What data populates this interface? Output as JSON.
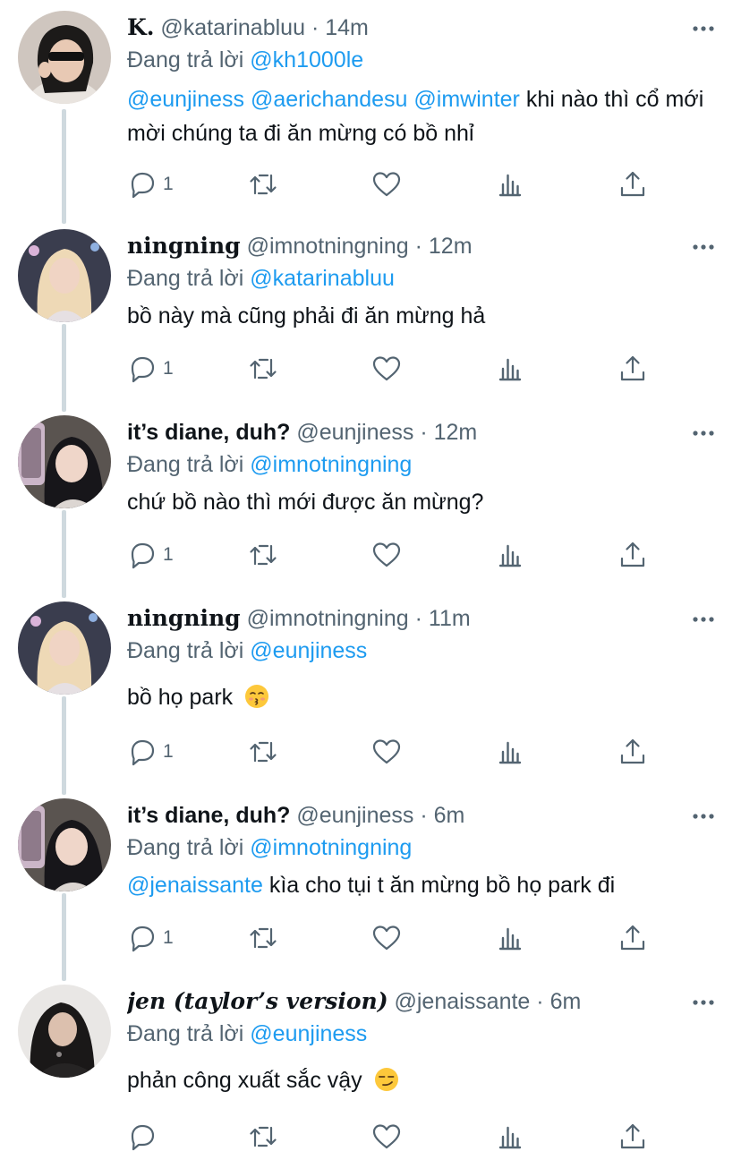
{
  "colors": {
    "link": "#1d9bf0",
    "text": "#0f1419",
    "secondary": "#536471",
    "thread_line": "#cfd9de",
    "background": "#ffffff"
  },
  "icons": {
    "more": "more-horizontal-icon",
    "reply": "reply-icon",
    "retweet": "retweet-icon",
    "like": "heart-icon",
    "analytics": "analytics-icon",
    "share": "share-icon"
  },
  "tweets": [
    {
      "name": "K.",
      "handle": "@katarinabluu",
      "separator": "·",
      "time": "14m",
      "replying_prefix": "Đang trả lời",
      "replying_to": "@kh1000le",
      "mentions": [
        "@eunjiness",
        "@aerichandesu",
        "@imwinter"
      ],
      "text": "khi nào thì cổ mới mời chúng ta đi ăn mừng có bồ nhỉ",
      "reply_count": "1"
    },
    {
      "name": "ningning",
      "handle": "@imnotningning",
      "separator": "·",
      "time": "12m",
      "replying_prefix": "Đang trả lời",
      "replying_to": "@katarinabluu",
      "text": "bồ này mà cũng phải đi ăn mừng hả",
      "reply_count": "1"
    },
    {
      "name": "it’s diane, duh?",
      "handle": "@eunjiness",
      "separator": "·",
      "time": "12m",
      "replying_prefix": "Đang trả lời",
      "replying_to": "@imnotningning",
      "text": "chứ bồ nào thì mới được ăn mừng?",
      "reply_count": "1"
    },
    {
      "name": "ningning",
      "handle": "@imnotningning",
      "separator": "·",
      "time": "11m",
      "replying_prefix": "Đang trả lời",
      "replying_to": "@eunjiness",
      "text": "bồ họ park",
      "emoji": "kissing-face-emoji",
      "reply_count": "1"
    },
    {
      "name": "it’s diane, duh?",
      "handle": "@eunjiness",
      "separator": "·",
      "time": "6m",
      "replying_prefix": "Đang trả lời",
      "replying_to": "@imnotningning",
      "mentions": [
        "@jenaissante"
      ],
      "text": "kìa cho tụi t ăn mừng bồ họ park đi",
      "reply_count": "1"
    },
    {
      "name": "jen (taylor’s version)",
      "handle": "@jenaissante",
      "separator": "·",
      "time": "6m",
      "replying_prefix": "Đang trả lời",
      "replying_to": "@eunjiness",
      "text": "phản công xuất sắc vậy",
      "emoji": "smirking-face-emoji",
      "reply_count": ""
    }
  ]
}
